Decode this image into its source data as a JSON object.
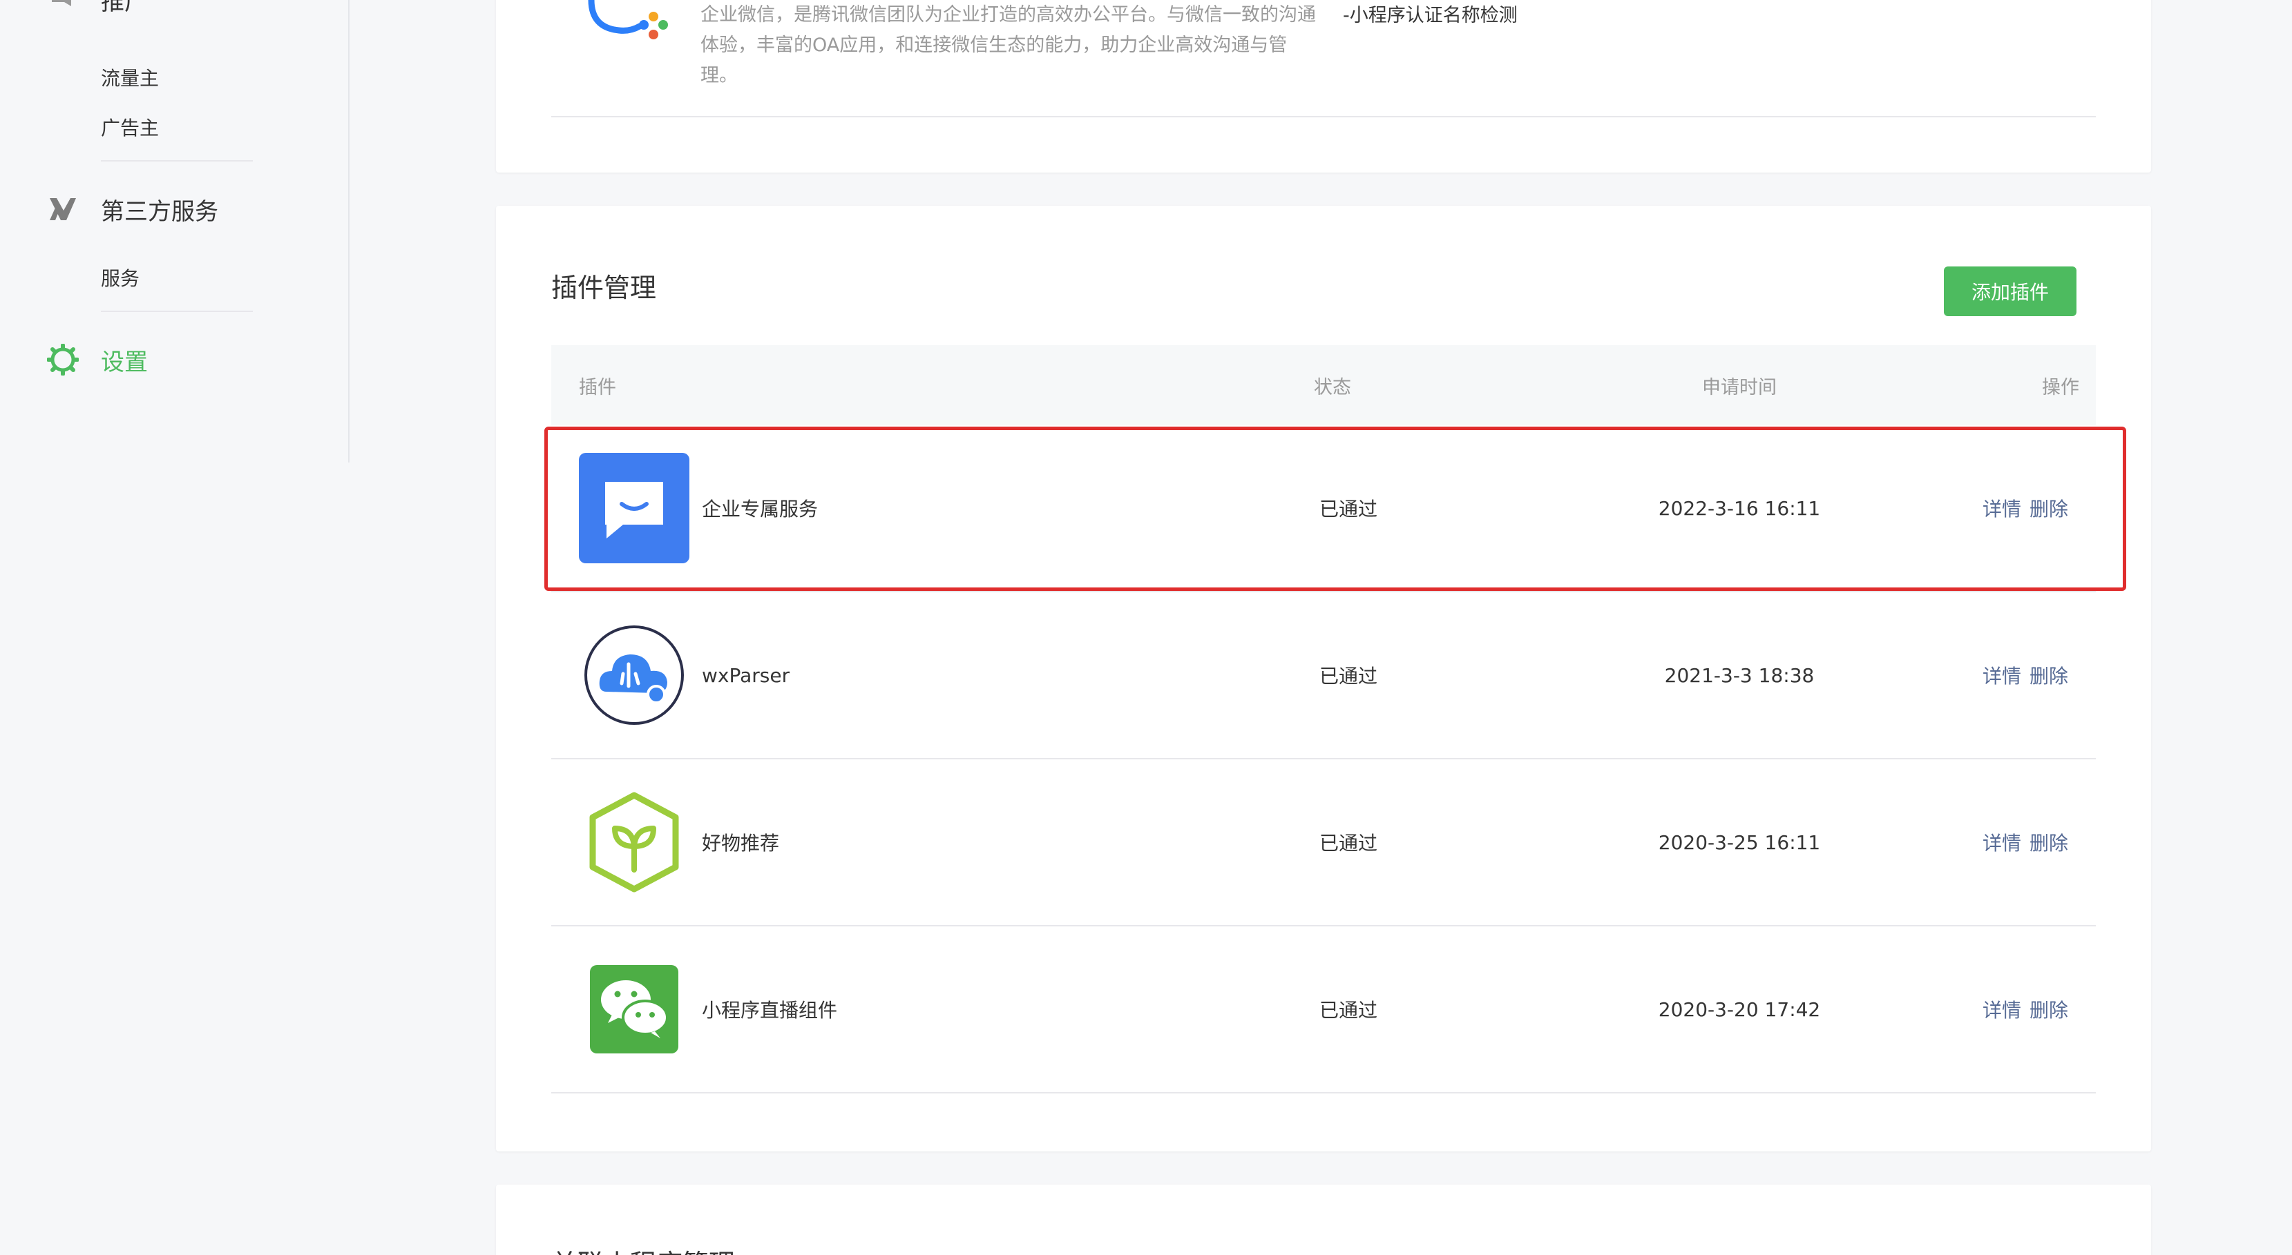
{
  "sidebar": {
    "promo": {
      "title": "推广",
      "items": [
        {
          "label": "流量主"
        },
        {
          "label": "广告主"
        }
      ]
    },
    "third_party": {
      "title": "第三方服务",
      "items": [
        {
          "label": "服务"
        }
      ]
    },
    "settings": {
      "title": "设置"
    }
  },
  "top_card": {
    "description": "企业微信，是腾讯微信团队为企业打造的高效办公平台。与微信一致的沟通体验，丰富的OA应用，和连接微信生态的能力，助力企业高效沟通与管理。",
    "note": "-小程序认证名称检测"
  },
  "plugins_card": {
    "title": "插件管理",
    "add_button": "添加插件",
    "columns": {
      "plugin": "插件",
      "status": "状态",
      "time": "申请时间",
      "ops": "操作"
    },
    "rows": [
      {
        "name": "企业专属服务",
        "status": "已通过",
        "time": "2022-3-16 16:11",
        "detail": "详情",
        "delete": "删除",
        "icon": "chat-bubble-icon"
      },
      {
        "name": "wxParser",
        "status": "已通过",
        "time": "2021-3-3 18:38",
        "detail": "详情",
        "delete": "删除",
        "icon": "cloud-icon"
      },
      {
        "name": "好物推荐",
        "status": "已通过",
        "time": "2020-3-25 16:11",
        "detail": "详情",
        "delete": "删除",
        "icon": "sprout-hexagon-icon"
      },
      {
        "name": "小程序直播组件",
        "status": "已通过",
        "time": "2020-3-20 17:42",
        "detail": "详情",
        "delete": "删除",
        "icon": "wechat-icon"
      }
    ]
  },
  "bottom_card": {
    "title": "关联小程序管理"
  },
  "colors": {
    "accent": "#4dbb5f",
    "link": "#576b95",
    "highlight": "#e02d2d"
  }
}
